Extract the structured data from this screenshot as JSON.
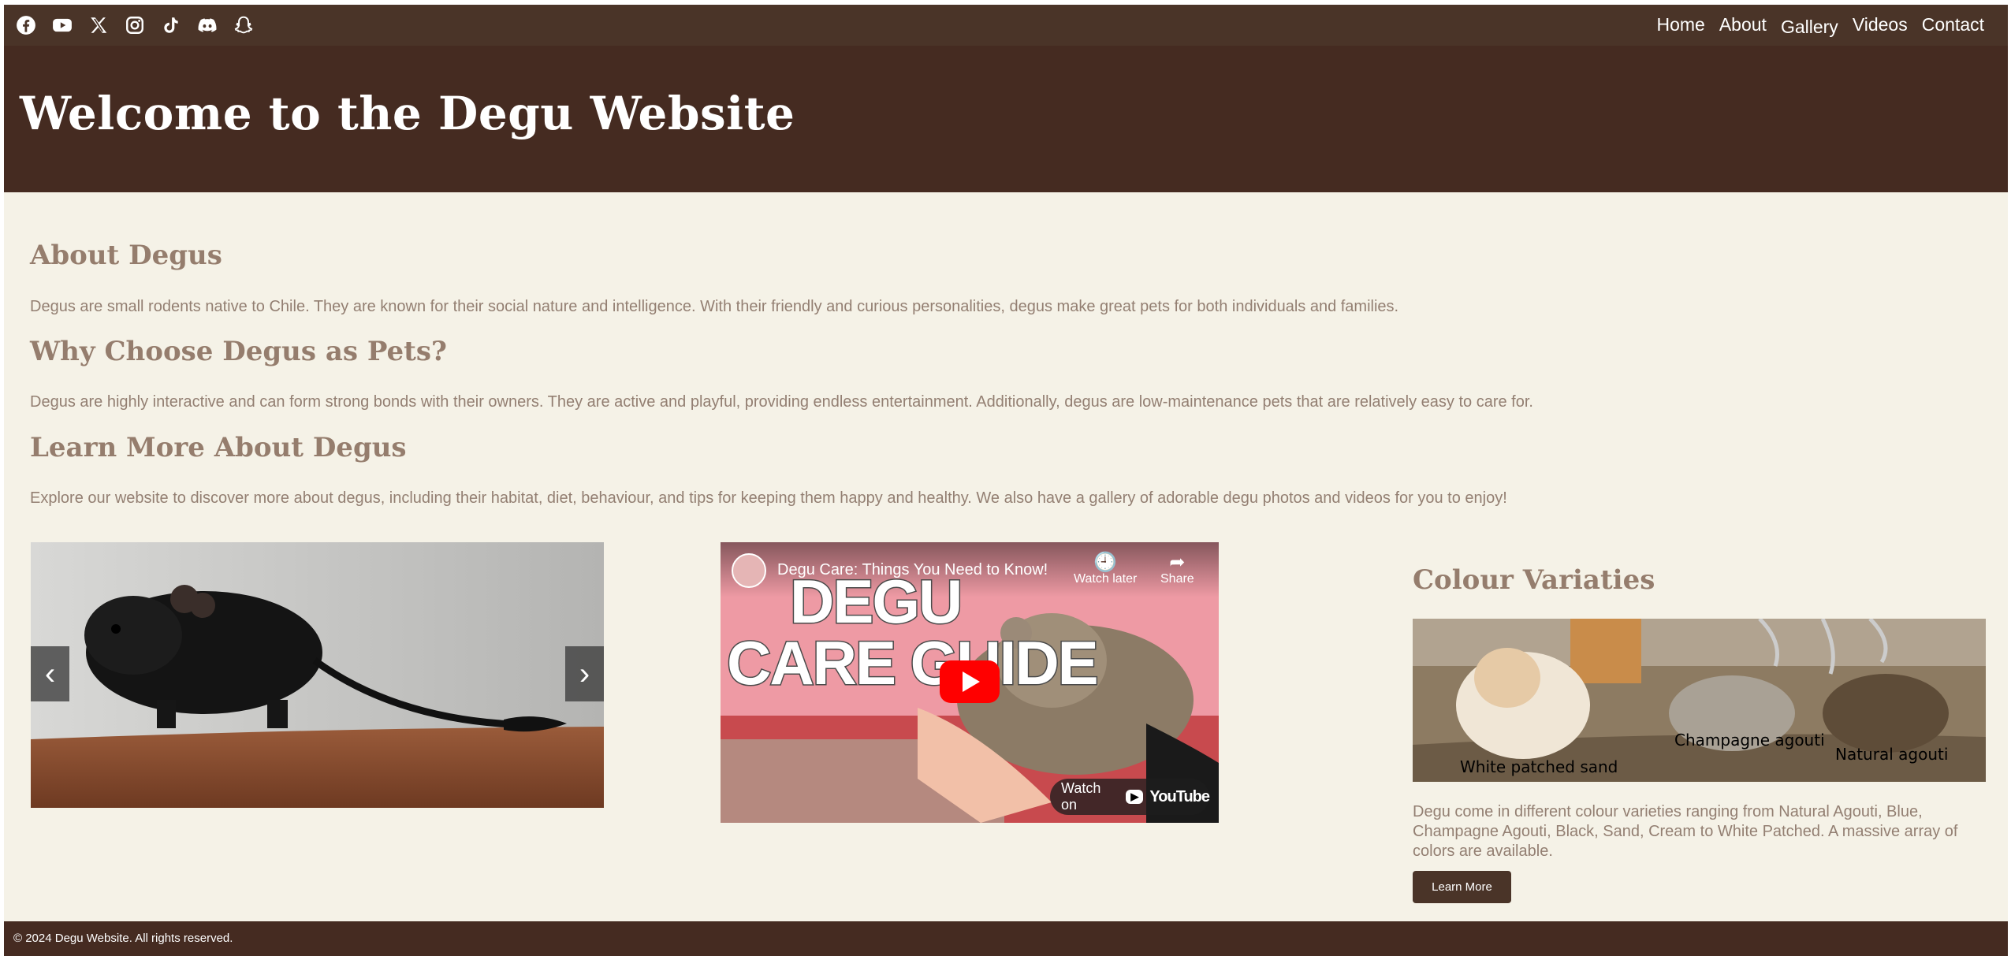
{
  "social_icons": [
    "facebook-icon",
    "youtube-icon",
    "x-twitter-icon",
    "instagram-icon",
    "tiktok-icon",
    "discord-icon",
    "snapchat-icon"
  ],
  "nav": {
    "home": "Home",
    "about": "About",
    "gallery": "Gallery",
    "videos": "Videos",
    "contact": "Contact"
  },
  "header": {
    "title": "Welcome to the Degu Website"
  },
  "sections": {
    "about": {
      "title": "About Degus",
      "text": "Degus are small rodents native to Chile. They are known for their social nature and intelligence. With their friendly and curious personalities, degus make great pets for both individuals and families."
    },
    "why": {
      "title": "Why Choose Degus as Pets?",
      "text": "Degus are highly interactive and can form strong bonds with their owners. They are active and playful, providing endless entertainment. Additionally, degus are low-maintenance pets that are relatively easy to care for."
    },
    "learn": {
      "title": "Learn More About Degus",
      "text": "Explore our website to discover more about degus, including their habitat, diet, behaviour, and tips for keeping them happy and healthy. We also have a gallery of adorable degu photos and videos for you to enjoy!"
    }
  },
  "carousel": {
    "prev": "‹",
    "next": "›"
  },
  "video": {
    "title": "Degu Care: Things You Need to Know!",
    "watch_later": "Watch later",
    "share": "Share",
    "cover_line1": "DEGU",
    "cover_line2": "CARE GUIDE",
    "watch_on": "Watch on",
    "yt_logo": "YouTube"
  },
  "colour_variaties": {
    "title": "Colour Variaties",
    "label_white": "White patched sand",
    "label_champagne": "Champagne agouti",
    "label_natural": "Natural agouti",
    "text": "Degu come in different colour varieties ranging from Natural Agouti, Blue, Champagne Agouti, Black, Sand, Cream to White Patched. A massive array of colors are available.",
    "button": "Learn More"
  },
  "footer": {
    "text": "© 2024 Degu Website. All rights reserved."
  },
  "colors": {
    "topbar": "#4a3428",
    "header": "#452b21",
    "background": "#f5f2e7",
    "heading": "#957d6d",
    "body_text": "#937f72"
  }
}
